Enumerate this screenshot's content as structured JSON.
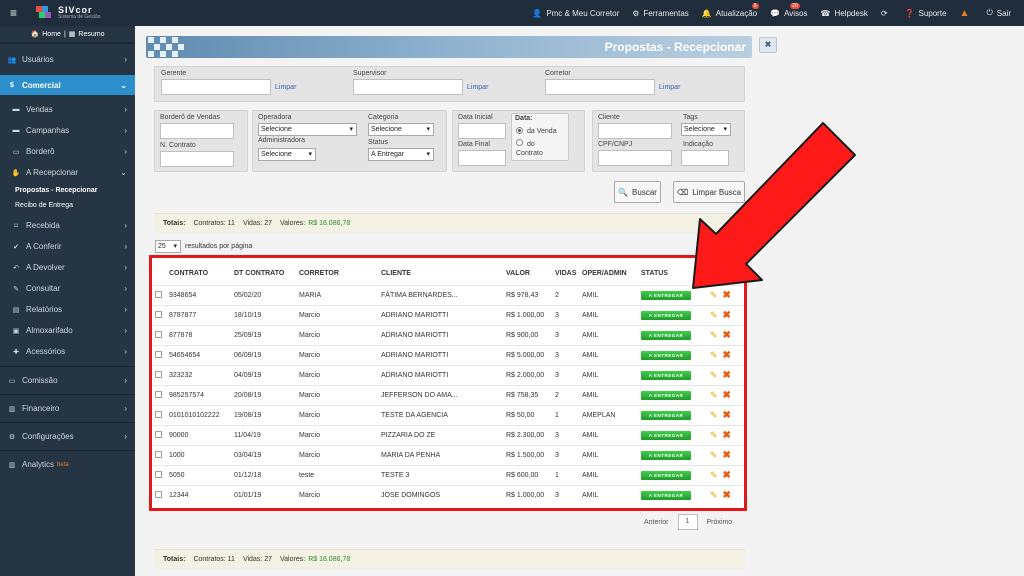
{
  "topbar": {
    "logo_name": "SIVcor",
    "logo_sub": "Sistema de Gestão",
    "items": [
      {
        "label": "Pmc & Meu Corretor",
        "icon": "user-icon"
      },
      {
        "label": "Ferramentas",
        "icon": "gears-icon"
      },
      {
        "label": "Atualização",
        "icon": "bell-icon",
        "badge": "6"
      },
      {
        "label": "Avisos",
        "icon": "chat-icon",
        "badge": "20"
      },
      {
        "label": "Helpdesk",
        "icon": "headset-icon"
      },
      {
        "label": "",
        "icon": "refresh-icon"
      },
      {
        "label": "Suporte",
        "icon": "question-icon"
      },
      {
        "label": "",
        "icon": "warning-icon"
      },
      {
        "label": "Sair",
        "icon": "power-icon"
      }
    ]
  },
  "sidebar": {
    "home": "Home",
    "resumo": "Resumo",
    "usuarios": "Usuários",
    "comercial": "Comercial",
    "vendas": "Vendas",
    "campanhas": "Campanhas",
    "bordero": "Borderô",
    "a_recepcionar": "A Recepcionar",
    "propostas_recepcionar": "Propostas - Recepcionar",
    "recibo_entrega": "Recibo de Entrega",
    "recebida": "Recebida",
    "a_conferir": "A Conferir",
    "a_devolver": "A Devolver",
    "consultar": "Consultar",
    "relatorios": "Relatórios",
    "almoxarifado": "Almoxarifado",
    "acessorios": "Acessórios",
    "comissao": "Comissão",
    "financeiro": "Financeiro",
    "configuracoes": "Configurações",
    "analytics": "Analytics",
    "beta": "beta"
  },
  "page_title": "Propostas - Recepcionar",
  "close_label": "✖",
  "filters": {
    "gerente": "Gerente",
    "supervisor": "Supervisor",
    "corretor": "Corretor",
    "limpar": "Limpar",
    "bordero_vendas": "Borderô de Vendas",
    "n_contrato": "N. Contrato",
    "operadora": "Operadora",
    "operadora_value": "Selecione",
    "administradora": "Administradora",
    "administradora_value": "Selecione",
    "categoria": "Categoria",
    "categoria_value": "Selecione",
    "status": "Status",
    "status_value": "A Entregar",
    "data_inicial": "Data Inicial",
    "data_final": "Data Final",
    "data": "Data:",
    "da_venda": "da Venda",
    "do_contrato_1": "do",
    "do_contrato_2": "Contrato",
    "cliente": "Cliente",
    "tags": "Tags",
    "tags_value": "Selecione",
    "cpf_cnpj": "CPF/CNPJ",
    "indicacao": "Indicação"
  },
  "buttons": {
    "buscar": "Buscar",
    "limpar_busca": "Limpar Busca"
  },
  "totals": {
    "label": "Totais:",
    "contratos": "Contratos: 11",
    "vidas": "Vidas: 27",
    "valores_label": "Valores:",
    "valores": "R$ 16.086,78"
  },
  "perpage": {
    "value": "25",
    "label": "resultados por página"
  },
  "table": {
    "headers": [
      "CONTRATO",
      "DT CONTRATO",
      "CORRETOR",
      "CLIENTE",
      "VALOR",
      "VIDAS",
      "OPER/ADMIN",
      "STATUS"
    ],
    "status_label": "A ENTREGAR",
    "rows": [
      [
        "9348654",
        "05/02/20",
        "MARIA",
        "FÁTIMA BERNARDES...",
        "R$ 978,43",
        "2",
        "AMIL"
      ],
      [
        "8787877",
        "18/10/19",
        "Marcio",
        "ADRIANO MARIOTTI",
        "R$ 1.000,00",
        "3",
        "AMIL"
      ],
      [
        "877878",
        "25/09/19",
        "Marcio",
        "ADRIANO MARIOTTI",
        "R$ 900,00",
        "3",
        "AMIL"
      ],
      [
        "54654654",
        "06/09/19",
        "Marcio",
        "ADRIANO MARIOTTI",
        "R$ 5.000,00",
        "3",
        "AMIL"
      ],
      [
        "323232",
        "04/09/19",
        "Marcio",
        "ADRIANO MARIOTTI",
        "R$ 2.000,00",
        "3",
        "AMIL"
      ],
      [
        "985257574",
        "20/08/19",
        "Marcio",
        "JEFFERSON DO AMA...",
        "R$ 758,35",
        "2",
        "AMIL"
      ],
      [
        "0101010102222",
        "19/08/19",
        "Marcio",
        "TESTE DA AGENCIA",
        "R$ 50,00",
        "1",
        "AMEPLAN"
      ],
      [
        "90000",
        "11/04/19",
        "Marcio",
        "PIZZARIA DO ZE",
        "R$ 2.300,00",
        "3",
        "AMIL"
      ],
      [
        "1000",
        "03/04/19",
        "Marcio",
        "MARIA DA PENHA",
        "R$ 1.500,00",
        "3",
        "AMIL"
      ],
      [
        "5050",
        "01/12/18",
        "teste",
        "TESTE 3",
        "R$ 600,00",
        "1",
        "AMIL"
      ],
      [
        "12344",
        "01/01/19",
        "Marcio",
        "JOSE DOMINGOS",
        "R$ 1.000,00",
        "3",
        "AMIL"
      ]
    ]
  },
  "pager": {
    "prev": "Anterior",
    "page": "1",
    "next": "Próximo"
  },
  "colors": {
    "accent": "#2c8fcb",
    "highlight_border": "#e0181b",
    "status_green": "#26a532",
    "arrow_red": "#ff1a1a"
  }
}
